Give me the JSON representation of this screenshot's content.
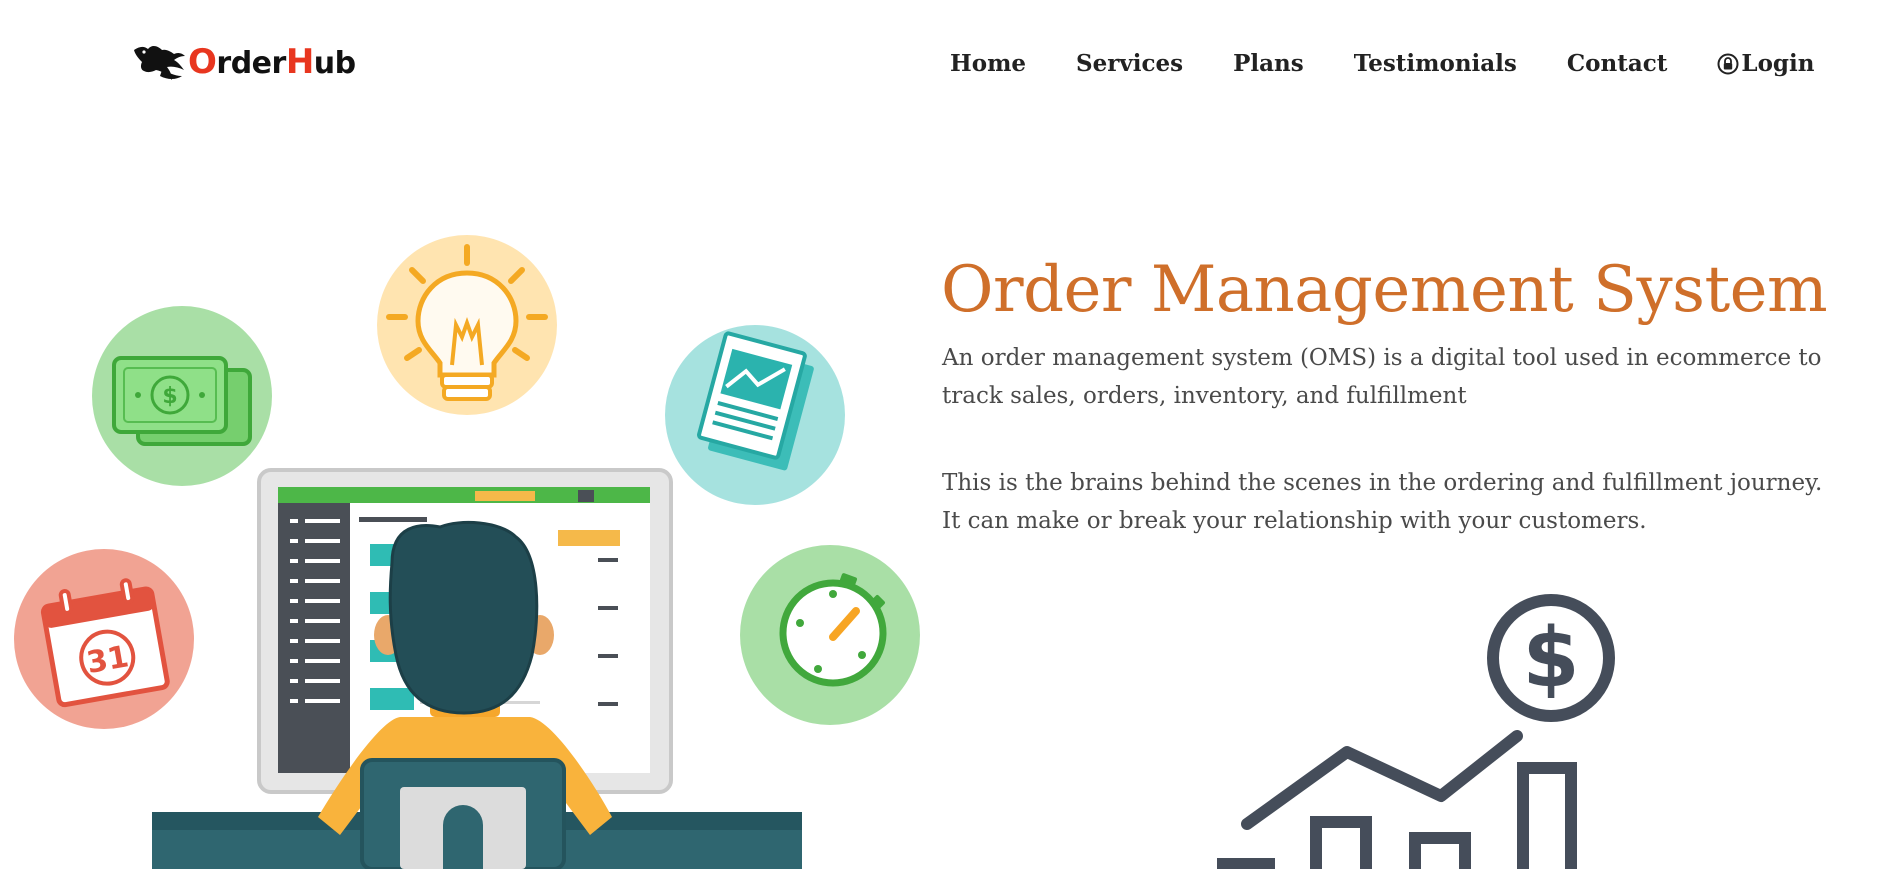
{
  "brand": {
    "name_parts": [
      "O",
      "rder",
      "H",
      "ub"
    ],
    "colors": {
      "accent": "#e8361f",
      "dark": "#111111"
    },
    "icon": "bird-logo-icon"
  },
  "nav": {
    "items": [
      {
        "label": "Home"
      },
      {
        "label": "Services"
      },
      {
        "label": "Plans"
      },
      {
        "label": "Testimonials"
      },
      {
        "label": "Contact"
      }
    ],
    "login": {
      "label": "Login",
      "icon": "lock-icon"
    }
  },
  "hero": {
    "title": "Order Management System",
    "title_color": "#cf6f2a",
    "paragraph1": "An order management system (OMS) is a digital tool used in ecommerce to track sales, orders, inventory, and fulfillment",
    "paragraph2": "This is the brains behind the scenes in the ordering and fulfillment journey. It can make or break your relationship with your customers."
  },
  "illustration": {
    "icons": [
      "money-icon",
      "lightbulb-icon",
      "report-chart-icon",
      "calendar-icon",
      "stopwatch-icon",
      "computer-user-illustration",
      "growth-chart-dollar-icon"
    ],
    "calendar_day": "31"
  }
}
